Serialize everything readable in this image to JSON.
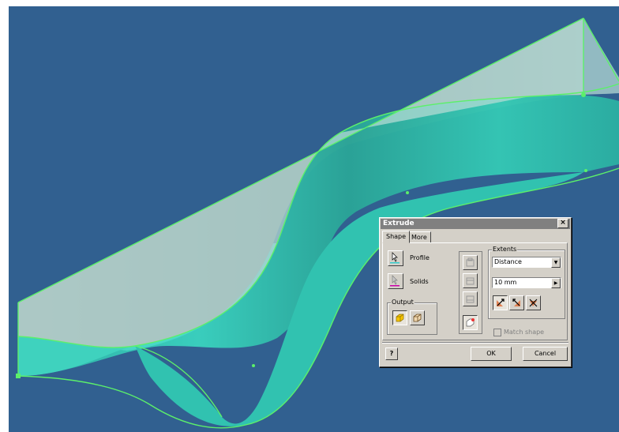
{
  "dialog": {
    "title": "Extrude",
    "close_symbol": "×",
    "tabs": [
      "Shape",
      "More"
    ],
    "profile_label": "Profile",
    "solids_label": "Solids",
    "output_label": "Output",
    "extents_label": "Extents",
    "extents_type": "Distance",
    "distance_value": "10 mm",
    "match_shape_label": "Match shape",
    "help_symbol": "?",
    "ok_label": "OK",
    "cancel_label": "Cancel"
  },
  "colors": {
    "viewport_bg": "#316090",
    "surface": "#36c7b4",
    "edge": "#5cf06a",
    "dialog_bg": "#d4d0c8",
    "titlebar": "#808080"
  },
  "icons": [
    "profile-select-icon",
    "solids-select-icon",
    "solid-output-icon",
    "surface-output-icon",
    "join-icon",
    "cut-icon",
    "intersect-icon",
    "new-solid-icon",
    "direction-1-icon",
    "direction-2-icon",
    "symmetric-icon",
    "help-icon"
  ]
}
